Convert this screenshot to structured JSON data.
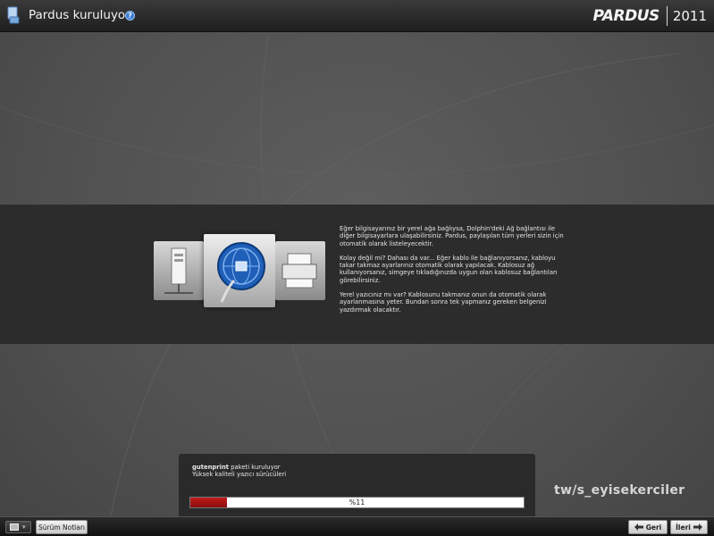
{
  "window": {
    "title": "Pardus kuruluyor",
    "help_icon": "?",
    "logo_word": "PARDUS",
    "logo_year": "2011"
  },
  "slide": {
    "icons": [
      "server-icon",
      "network-globe-icon",
      "printer-icon"
    ],
    "paragraphs": [
      "Eğer bilgisayarınız bir yerel ağa bağlıysa, Dolphin'deki Ağ bağlantısı ile diğer bilgisayarlara ulaşabilirsiniz. Pardus, paylaşılan tüm yerleri sizin için otomatik olarak listeleyecektir.",
      "Kolay değil mi? Dahası da var... Eğer kablo ile bağlanıyorsanız, kabloyu takar takmaz ayarlarınız otomatik olarak yapılacak. Kablosuz ağ kullanıyorsanız, simgeye tıkladığınızda uygun olan kablosuz bağlantıları görebilirsiniz.",
      "Yerel yazıcınız mı var? Kablosunu takmanız onun da otomatik olarak ayarlanmasına yeter. Bundan sonra tek yapmanız gereken belgenizi yazdırmak olacaktır."
    ]
  },
  "progress": {
    "package_name": "gutenprint",
    "package_action": " paketi kuruluyor",
    "package_description": "Yüksek kaliteli yazıcı sürücüleri",
    "percent": 11,
    "label": "%11",
    "fill_color": "#b01717"
  },
  "watermark": "tw/s_eyisekerciler",
  "footer": {
    "release_notes_label": "Sürüm Notları",
    "back_label": "Geri",
    "next_label": "İleri",
    "keyboard_icon": "keyboard-icon"
  }
}
